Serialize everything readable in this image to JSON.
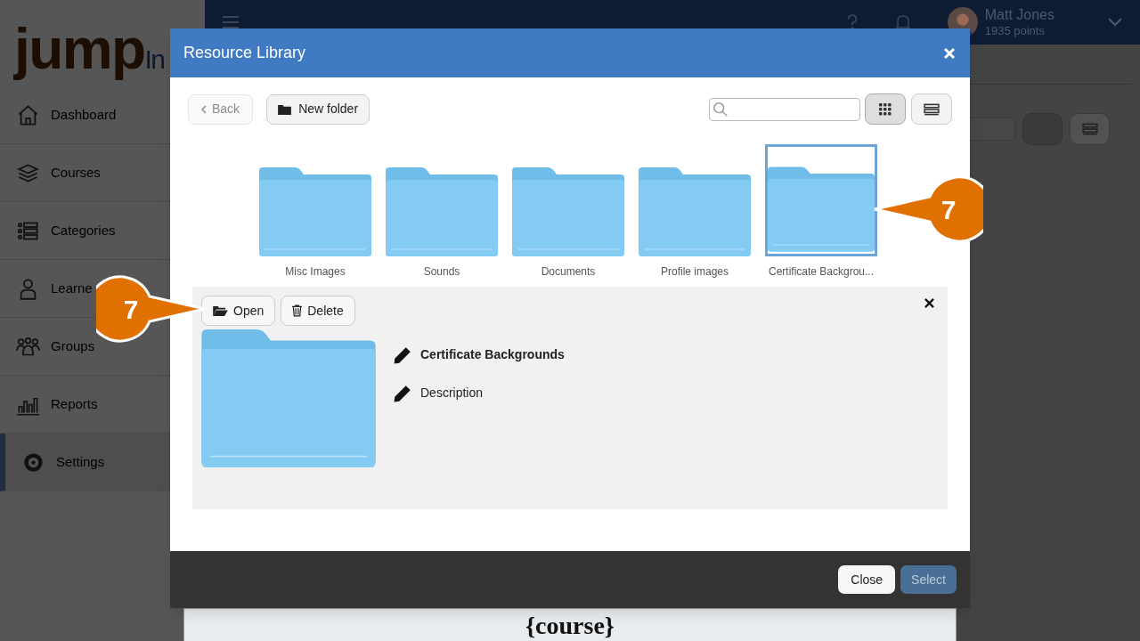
{
  "app": {
    "logo": {
      "main": "jump",
      "suffix": "In"
    },
    "user": {
      "name": "Matt Jones",
      "points": "1935 points"
    },
    "sidebar": [
      {
        "label": "Dashboard",
        "selected": false
      },
      {
        "label": "Courses",
        "selected": false
      },
      {
        "label": "Categories",
        "selected": false
      },
      {
        "label": "Learne",
        "selected": false
      },
      {
        "label": "Groups",
        "selected": false
      },
      {
        "label": "Reports",
        "selected": false
      },
      {
        "label": "Settings",
        "selected": true
      }
    ],
    "certificate": {
      "heading": "{course}"
    }
  },
  "dialog": {
    "title": "Resource Library",
    "toolbar": {
      "back": {
        "label": "Back",
        "disabled": true
      },
      "new_folder": "New folder",
      "views": [
        {
          "kind": "grid",
          "selected": true
        },
        {
          "kind": "list",
          "selected": false
        }
      ]
    },
    "folders": [
      {
        "name": "Misc Images",
        "selected": false
      },
      {
        "name": "Sounds",
        "selected": false
      },
      {
        "name": "Documents",
        "selected": false
      },
      {
        "name": "Profile images",
        "selected": false
      },
      {
        "name": "Certificate Backgrou...",
        "selected": true
      }
    ],
    "details": {
      "actions": [
        "Open",
        "Delete"
      ],
      "name": "Certificate Backgrounds",
      "description": "Description"
    },
    "footer": {
      "close": "Close",
      "select": {
        "label": "Select",
        "disabled": true
      }
    }
  },
  "callouts": [
    {
      "number": "7"
    },
    {
      "number": "7"
    }
  ]
}
